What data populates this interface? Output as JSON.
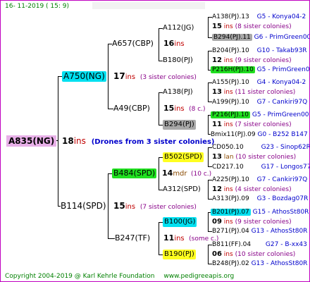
{
  "header": {
    "date": "16-  11-2019  (  15:   9)"
  },
  "footer": {
    "copyright": "Copyright 2004-2019 @ Karl Kehrle Foundation",
    "site": "www.pedigreeapis.org"
  },
  "colors": {
    "border": "#c000c0",
    "root": "#e8b0e8",
    "cyan": "#00e0f0",
    "green": "#20e020",
    "yellow": "#ffff20",
    "gray": "#a8a8a8"
  },
  "root": {
    "id": "A835(NG)",
    "ins_num": "18",
    "ins": "ins",
    "note": "(Drones from 3 sister colonies)"
  },
  "nodes": [
    {
      "id": "A750(NG)",
      "ins_num": "17",
      "ins": "ins",
      "note": "(3 sister colonies)"
    },
    {
      "id": "A657(CBP)",
      "ins_num": "16",
      "ins": "ins",
      "note": ""
    },
    {
      "id": "A49(CBP)",
      "ins_num": "15",
      "ins": "ins",
      "note": "(8 c.)"
    },
    {
      "id": "B114(SPD)",
      "ins_num": "15",
      "ins": "ins",
      "note": "(7 sister colonies)"
    },
    {
      "id": "B484(SPD)",
      "ins_num": "14",
      "ins": "mdr",
      "note": "(10 c.)"
    },
    {
      "id": "B247(TF)",
      "ins_num": "11",
      "ins": "ins",
      "note": "(some c.)"
    }
  ],
  "groups": [
    {
      "mother": "A112(JG)",
      "ins_num": "15",
      "ins": "ins",
      "note": "(8 sister colonies)",
      "top": "A138(PJ).13",
      "top_tag": "G5 - Konya04-2",
      "bottom": "B294(PJ).11",
      "bottom_tag": "G6 - PrimGreen00"
    },
    {
      "mother": "B180(PJ)",
      "ins_num": "12",
      "ins": "ins",
      "note": "(9 sister colonies)",
      "top": "B204(PJ).10",
      "top_tag": "G10 - Takab93R",
      "bottom": "P216H(PJ).10",
      "bottom_tag": "G5 - PrimGreen00"
    },
    {
      "mother": "A138(PJ)",
      "ins_num": "13",
      "ins": "ins",
      "note": "(11 sister colonies)",
      "top": "A155(PJ).10",
      "top_tag": "G4 - Konya04-2",
      "bottom": "A199(PJ).10",
      "bottom_tag": "G7 - Cankiri97Q"
    },
    {
      "mother": "B294(PJ)",
      "ins_num": "11",
      "ins": "ins",
      "note": "(7 sister colonies)",
      "top": "P216(PJ).10",
      "top_tag": "G5 - PrimGreen00",
      "bottom": "Bmix11(PJ).09",
      "bottom_tag": "G0 - B252 B147 B"
    },
    {
      "mother": "B502(SPD)",
      "ins_num": "13",
      "ins": "lan",
      "note": "(10 sister colonies)",
      "top": "CD050.10",
      "top_tag": "G23 - Sinop62R",
      "bottom": "CD217.10",
      "bottom_tag": "G17 - Longos77R"
    },
    {
      "mother": "A312(SPD)",
      "ins_num": "12",
      "ins": "ins",
      "note": "(4 sister colonies)",
      "top": "A225(PJ).10",
      "top_tag": "G7 - Cankiri97Q",
      "bottom": "A313(PJ).09",
      "bottom_tag": "G3 - Bozdag07R"
    },
    {
      "mother": "B100(JG)",
      "ins_num": "09",
      "ins": "ins",
      "note": "(9 sister colonies)",
      "top": "B201(PJ).07",
      "top_tag": "G15 - AthosSt80R",
      "bottom": "B271(PJ).04",
      "bottom_tag": "G13 - AthosSt80R"
    },
    {
      "mother": "B190(PJ)",
      "ins_num": "06",
      "ins": "ins",
      "note": "(10 sister colonies)",
      "top": "B811(FF).04",
      "top_tag": "G27 - B-xx43",
      "bottom": "B248(PJ).02",
      "bottom_tag": "G13 - AthosSt80R"
    }
  ]
}
